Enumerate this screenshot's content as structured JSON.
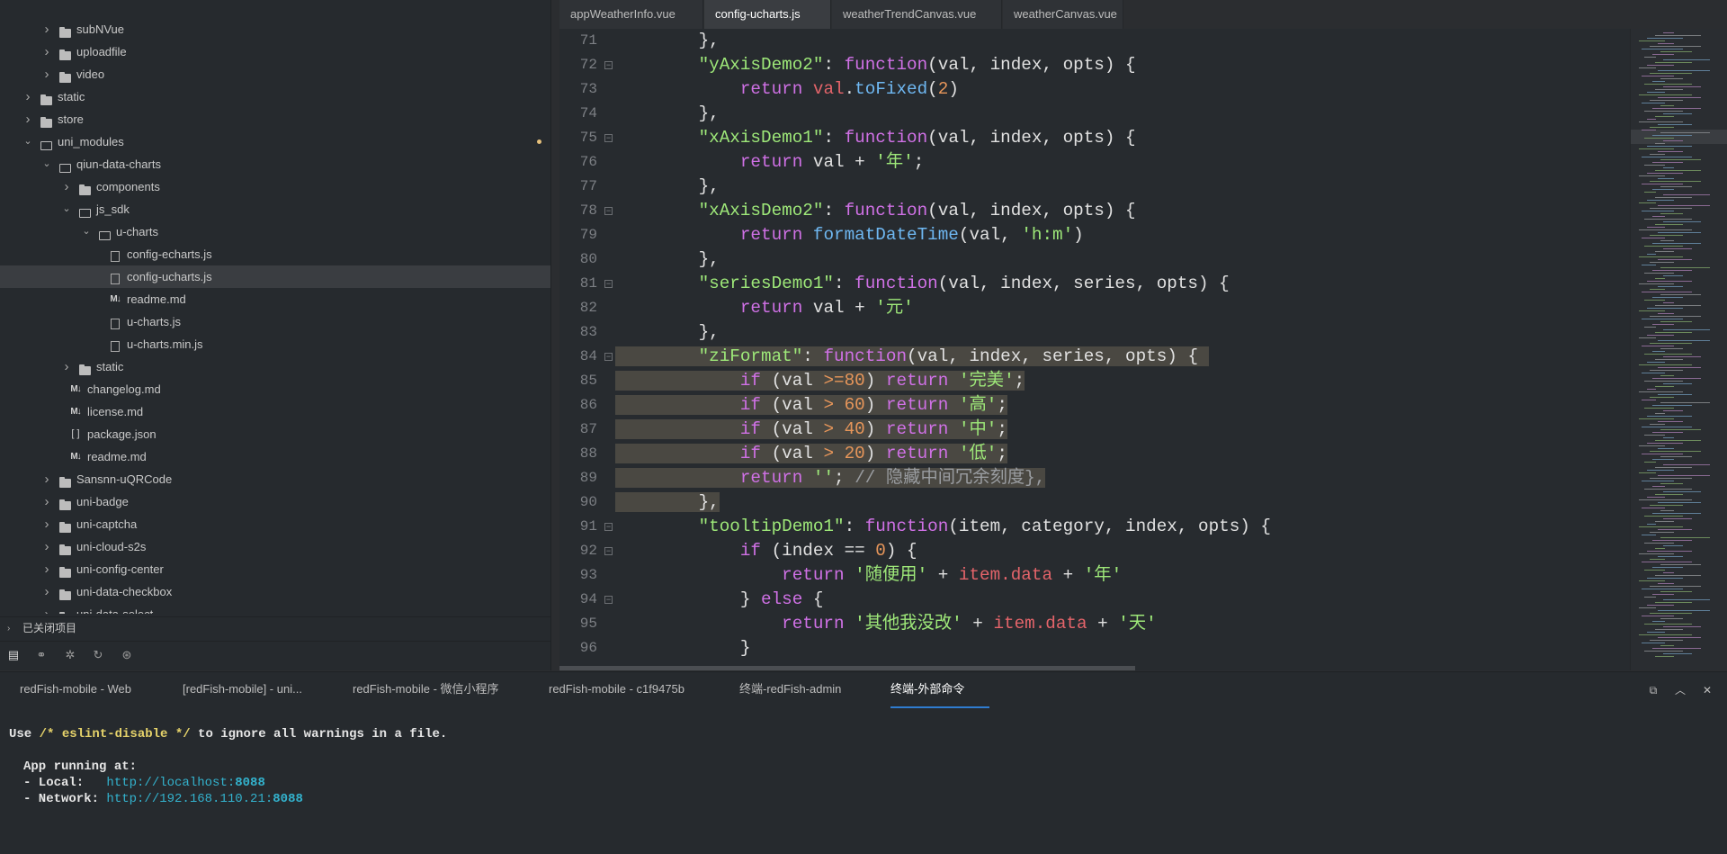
{
  "sidebar": {
    "tree": [
      {
        "label": "subNVue",
        "type": "folder",
        "depth": 2,
        "expanded": false
      },
      {
        "label": "uploadfile",
        "type": "folder",
        "depth": 2,
        "expanded": false
      },
      {
        "label": "video",
        "type": "folder",
        "depth": 2,
        "expanded": false
      },
      {
        "label": "static",
        "type": "folder",
        "depth": 1,
        "expanded": false
      },
      {
        "label": "store",
        "type": "folder",
        "depth": 1,
        "expanded": false
      },
      {
        "label": "uni_modules",
        "type": "folder",
        "depth": 1,
        "expanded": true,
        "modified": true
      },
      {
        "label": "qiun-data-charts",
        "type": "folder",
        "depth": 2,
        "expanded": true
      },
      {
        "label": "components",
        "type": "folder",
        "depth": 3,
        "expanded": false
      },
      {
        "label": "js_sdk",
        "type": "folder",
        "depth": 3,
        "expanded": true
      },
      {
        "label": "u-charts",
        "type": "folder",
        "depth": 4,
        "expanded": true
      },
      {
        "label": "config-echarts.js",
        "type": "file",
        "depth": 5
      },
      {
        "label": "config-ucharts.js",
        "type": "file",
        "depth": 5,
        "selected": true
      },
      {
        "label": "readme.md",
        "type": "md",
        "depth": 5
      },
      {
        "label": "u-charts.js",
        "type": "file",
        "depth": 5
      },
      {
        "label": "u-charts.min.js",
        "type": "file",
        "depth": 5
      },
      {
        "label": "static",
        "type": "folder",
        "depth": 3,
        "expanded": false
      },
      {
        "label": "changelog.md",
        "type": "md",
        "depth": 3
      },
      {
        "label": "license.md",
        "type": "md",
        "depth": 3
      },
      {
        "label": "package.json",
        "type": "json",
        "depth": 3
      },
      {
        "label": "readme.md",
        "type": "md",
        "depth": 3
      },
      {
        "label": "Sansnn-uQRCode",
        "type": "folder",
        "depth": 2,
        "expanded": false
      },
      {
        "label": "uni-badge",
        "type": "folder",
        "depth": 2,
        "expanded": false
      },
      {
        "label": "uni-captcha",
        "type": "folder",
        "depth": 2,
        "expanded": false
      },
      {
        "label": "uni-cloud-s2s",
        "type": "folder",
        "depth": 2,
        "expanded": false
      },
      {
        "label": "uni-config-center",
        "type": "folder",
        "depth": 2,
        "expanded": false
      },
      {
        "label": "uni-data-checkbox",
        "type": "folder",
        "depth": 2,
        "expanded": false
      },
      {
        "label": "uni-data-select",
        "type": "folder",
        "depth": 2,
        "expanded": false
      }
    ],
    "closed_projects": "已关闭项目",
    "toolbar_icons": [
      "project-explorer-icon",
      "search-binoculars-icon",
      "debug-bug-icon",
      "git-icon",
      "plugin-icon"
    ]
  },
  "editor": {
    "tabs": [
      {
        "label": "appWeatherInfo.vue",
        "active": false
      },
      {
        "label": "config-ucharts.js",
        "active": true
      },
      {
        "label": "weatherTrendCanvas.vue",
        "active": false
      },
      {
        "label": "weatherCanvas.vue",
        "active": false
      }
    ],
    "lines": [
      {
        "n": "71",
        "fold": false,
        "hl": false,
        "t": [
          [
            "pl",
            "        },"
          ]
        ]
      },
      {
        "n": "72",
        "fold": true,
        "hl": false,
        "t": [
          [
            "pl",
            "        "
          ],
          [
            "key",
            "\"yAxisDemo2\""
          ],
          [
            "pl",
            ": "
          ],
          [
            "kw",
            "function"
          ],
          [
            "pl",
            "(val, index, opts) {"
          ]
        ]
      },
      {
        "n": "73",
        "fold": false,
        "hl": false,
        "t": [
          [
            "pl",
            "            "
          ],
          [
            "kw",
            "return"
          ],
          [
            "pl",
            " "
          ],
          [
            "var",
            "val"
          ],
          [
            "pl",
            "."
          ],
          [
            "fn",
            "toFixed"
          ],
          [
            "pl",
            "("
          ],
          [
            "num",
            "2"
          ],
          [
            "pl",
            ")"
          ]
        ]
      },
      {
        "n": "74",
        "fold": false,
        "hl": false,
        "t": [
          [
            "pl",
            "        },"
          ]
        ]
      },
      {
        "n": "75",
        "fold": true,
        "hl": false,
        "t": [
          [
            "pl",
            "        "
          ],
          [
            "key",
            "\"xAxisDemo1\""
          ],
          [
            "pl",
            ": "
          ],
          [
            "kw",
            "function"
          ],
          [
            "pl",
            "(val, index, opts) {"
          ]
        ]
      },
      {
        "n": "76",
        "fold": false,
        "hl": false,
        "t": [
          [
            "pl",
            "            "
          ],
          [
            "kw",
            "return"
          ],
          [
            "pl",
            " val + "
          ],
          [
            "str",
            "'年'"
          ],
          [
            "pl",
            ";"
          ]
        ]
      },
      {
        "n": "77",
        "fold": false,
        "hl": false,
        "t": [
          [
            "pl",
            "        },"
          ]
        ]
      },
      {
        "n": "78",
        "fold": true,
        "hl": false,
        "t": [
          [
            "pl",
            "        "
          ],
          [
            "key",
            "\"xAxisDemo2\""
          ],
          [
            "pl",
            ": "
          ],
          [
            "kw",
            "function"
          ],
          [
            "pl",
            "(val, index, opts) {"
          ]
        ]
      },
      {
        "n": "79",
        "fold": false,
        "hl": false,
        "t": [
          [
            "pl",
            "            "
          ],
          [
            "kw",
            "return"
          ],
          [
            "pl",
            " "
          ],
          [
            "fn",
            "formatDateTime"
          ],
          [
            "pl",
            "(val, "
          ],
          [
            "str",
            "'h:m'"
          ],
          [
            "pl",
            ")"
          ]
        ]
      },
      {
        "n": "80",
        "fold": false,
        "hl": false,
        "t": [
          [
            "pl",
            "        },"
          ]
        ]
      },
      {
        "n": "81",
        "fold": true,
        "hl": false,
        "t": [
          [
            "pl",
            "        "
          ],
          [
            "key",
            "\"seriesDemo1\""
          ],
          [
            "pl",
            ": "
          ],
          [
            "kw",
            "function"
          ],
          [
            "pl",
            "(val, index, series, opts) {"
          ]
        ]
      },
      {
        "n": "82",
        "fold": false,
        "hl": false,
        "t": [
          [
            "pl",
            "            "
          ],
          [
            "kw",
            "return"
          ],
          [
            "pl",
            " val + "
          ],
          [
            "str",
            "'元'"
          ]
        ]
      },
      {
        "n": "83",
        "fold": false,
        "hl": false,
        "t": [
          [
            "pl",
            "        },"
          ]
        ]
      },
      {
        "n": "84",
        "fold": true,
        "hl": true,
        "t": [
          [
            "pl",
            "        "
          ],
          [
            "key",
            "\"ziFormat\""
          ],
          [
            "pl",
            ": "
          ],
          [
            "kw",
            "function"
          ],
          [
            "pl",
            "(val, index, series, opts) { "
          ]
        ]
      },
      {
        "n": "85",
        "fold": false,
        "hl": true,
        "t": [
          [
            "pl",
            "            "
          ],
          [
            "kw",
            "if"
          ],
          [
            "pl",
            " (val "
          ],
          [
            "op",
            ">="
          ],
          [
            "num",
            "80"
          ],
          [
            "pl",
            ") "
          ],
          [
            "kw",
            "return"
          ],
          [
            "pl",
            " "
          ],
          [
            "str",
            "'完美'"
          ],
          [
            "pl",
            ";"
          ]
        ]
      },
      {
        "n": "86",
        "fold": false,
        "hl": true,
        "t": [
          [
            "pl",
            "            "
          ],
          [
            "kw",
            "if"
          ],
          [
            "pl",
            " (val "
          ],
          [
            "op",
            ">"
          ],
          [
            "pl",
            " "
          ],
          [
            "num",
            "60"
          ],
          [
            "pl",
            ") "
          ],
          [
            "kw",
            "return"
          ],
          [
            "pl",
            " "
          ],
          [
            "str",
            "'高'"
          ],
          [
            "pl",
            ";"
          ]
        ]
      },
      {
        "n": "87",
        "fold": false,
        "hl": true,
        "t": [
          [
            "pl",
            "            "
          ],
          [
            "kw",
            "if"
          ],
          [
            "pl",
            " (val "
          ],
          [
            "op",
            ">"
          ],
          [
            "pl",
            " "
          ],
          [
            "num",
            "40"
          ],
          [
            "pl",
            ") "
          ],
          [
            "kw",
            "return"
          ],
          [
            "pl",
            " "
          ],
          [
            "str",
            "'中'"
          ],
          [
            "pl",
            ";"
          ]
        ]
      },
      {
        "n": "88",
        "fold": false,
        "hl": true,
        "t": [
          [
            "pl",
            "            "
          ],
          [
            "kw",
            "if"
          ],
          [
            "pl",
            " (val "
          ],
          [
            "op",
            ">"
          ],
          [
            "pl",
            " "
          ],
          [
            "num",
            "20"
          ],
          [
            "pl",
            ") "
          ],
          [
            "kw",
            "return"
          ],
          [
            "pl",
            " "
          ],
          [
            "str",
            "'低'"
          ],
          [
            "pl",
            ";"
          ]
        ]
      },
      {
        "n": "89",
        "fold": false,
        "hl": true,
        "t": [
          [
            "pl",
            "            "
          ],
          [
            "kw",
            "return"
          ],
          [
            "pl",
            " "
          ],
          [
            "str",
            "''"
          ],
          [
            "pl",
            "; "
          ],
          [
            "com",
            "// 隐藏中间冗余刻度},"
          ]
        ]
      },
      {
        "n": "90",
        "fold": false,
        "hl": true,
        "t": [
          [
            "pl",
            "        },"
          ]
        ]
      },
      {
        "n": "91",
        "fold": true,
        "hl": false,
        "t": [
          [
            "pl",
            "        "
          ],
          [
            "key",
            "\"tooltipDemo1\""
          ],
          [
            "pl",
            ": "
          ],
          [
            "kw",
            "function"
          ],
          [
            "pl",
            "(item, category, index, opts) {"
          ]
        ]
      },
      {
        "n": "92",
        "fold": true,
        "hl": false,
        "t": [
          [
            "pl",
            "            "
          ],
          [
            "kw",
            "if"
          ],
          [
            "pl",
            " (index == "
          ],
          [
            "num",
            "0"
          ],
          [
            "pl",
            ") {"
          ]
        ]
      },
      {
        "n": "93",
        "fold": false,
        "hl": false,
        "t": [
          [
            "pl",
            "                "
          ],
          [
            "kw",
            "return"
          ],
          [
            "pl",
            " "
          ],
          [
            "str",
            "'随便用'"
          ],
          [
            "pl",
            " + "
          ],
          [
            "var",
            "item.data"
          ],
          [
            "pl",
            " + "
          ],
          [
            "str",
            "'年'"
          ]
        ]
      },
      {
        "n": "94",
        "fold": true,
        "hl": false,
        "t": [
          [
            "pl",
            "            } "
          ],
          [
            "kw",
            "else"
          ],
          [
            "pl",
            " {"
          ]
        ]
      },
      {
        "n": "95",
        "fold": false,
        "hl": false,
        "t": [
          [
            "pl",
            "                "
          ],
          [
            "kw",
            "return"
          ],
          [
            "pl",
            " "
          ],
          [
            "str",
            "'其他我没改'"
          ],
          [
            "pl",
            " + "
          ],
          [
            "var",
            "item.data"
          ],
          [
            "pl",
            " + "
          ],
          [
            "str",
            "'天'"
          ]
        ]
      },
      {
        "n": "96",
        "fold": false,
        "hl": false,
        "t": [
          [
            "pl",
            "            }"
          ]
        ]
      }
    ],
    "colors": {
      "key": "#9ee879",
      "kw": "#d071e6",
      "str": "#9ee879",
      "num": "#e7965a",
      "fn": "#6fb8f2",
      "var": "#e4646a",
      "op": "#e7965a",
      "com": "#9a9da1",
      "pl": "#e1e1e1"
    }
  },
  "terminal": {
    "tabs": [
      {
        "label": "redFish-mobile - Web",
        "active": false
      },
      {
        "label": "[redFish-mobile] - uni...",
        "active": false
      },
      {
        "label": "redFish-mobile - 微信小程序",
        "active": false
      },
      {
        "label": "redFish-mobile - c1f9475b",
        "active": false
      },
      {
        "label": "终端-redFish-admin",
        "active": false
      },
      {
        "label": "终端-外部命令",
        "active": true
      }
    ],
    "controls": [
      "maximize-icon",
      "collapse-chevron-up-icon",
      "close-all-icon"
    ],
    "output": {
      "line1_pre": "Use ",
      "line1_comment": "/* eslint-disable */",
      "line1_post": " to ignore all warnings in a file.",
      "app_running": "App running at:",
      "local_label": "- Local:   ",
      "local_url": "http://localhost:",
      "local_port": "8088",
      "network_label": "- Network: ",
      "network_url": "http://192.168.110.21:",
      "network_port": "8088"
    }
  }
}
